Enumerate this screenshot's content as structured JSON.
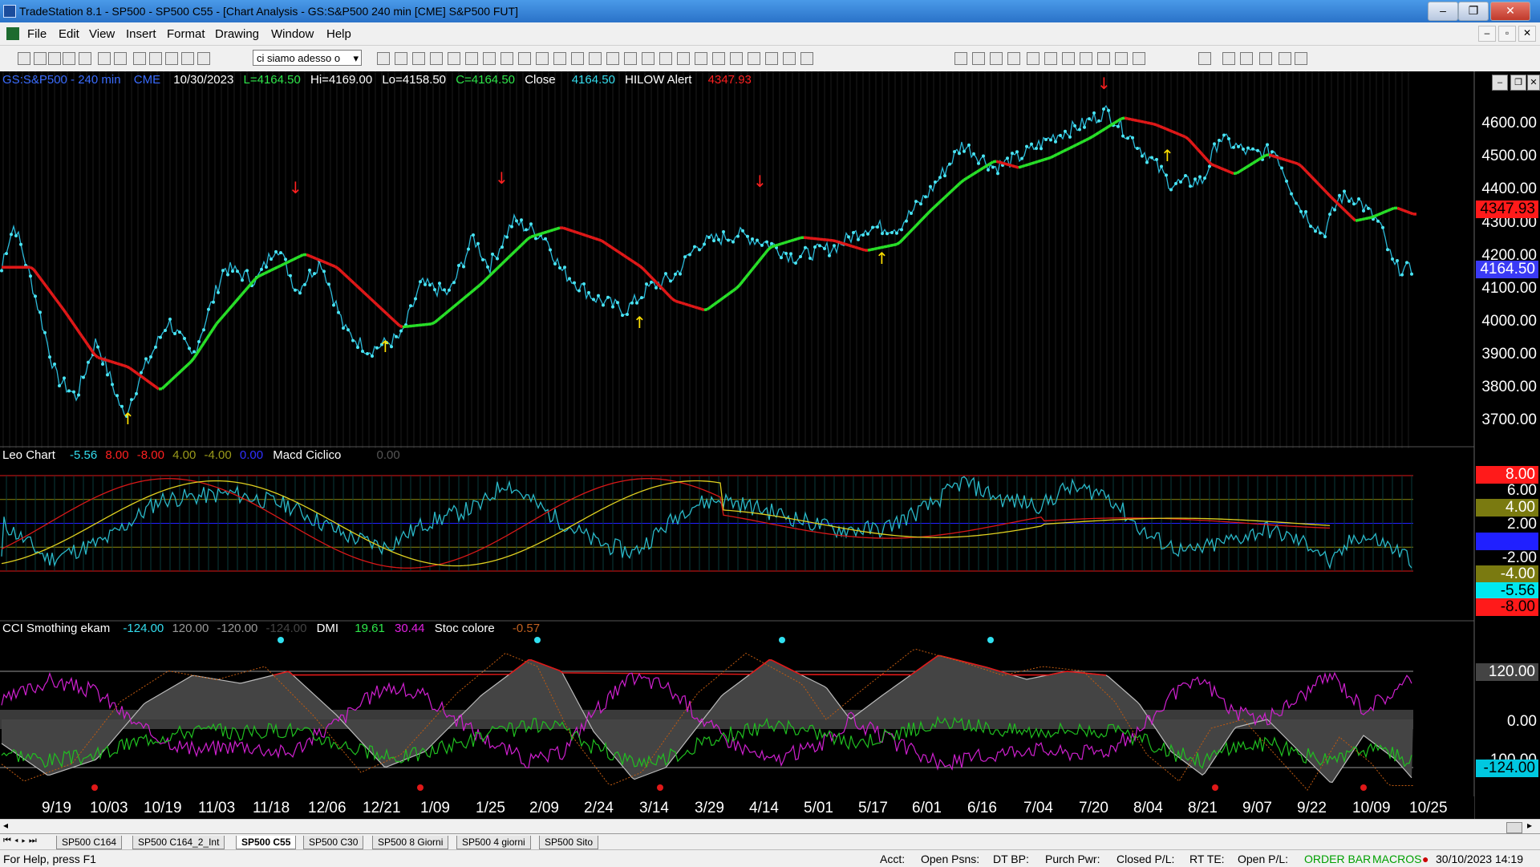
{
  "window": {
    "title": "TradeStation 8.1 - SP500 - SP500 C55 - [Chart Analysis - GS:S&P500  240 min  [CME] S&P500 FUT]",
    "minimize": "‒",
    "restore": "❐",
    "close": "✕"
  },
  "menu": {
    "items": [
      "File",
      "Edit",
      "View",
      "Insert",
      "Format",
      "Drawing",
      "Window",
      "Help"
    ],
    "mdi_minimize": "‒",
    "mdi_restore": "▫",
    "mdi_close": "✕"
  },
  "toolbar": {
    "workspace_select": "ci siamo adesso o",
    "icons": [
      "new-icon",
      "open-icon",
      "save-all-icon",
      "copy-icon",
      "folder-icon",
      "print-preview-icon",
      "print-icon",
      "link-icon",
      "link-2-icon",
      "lock-icon",
      "tool-icon",
      "globe-icon",
      "arrow-right-icon",
      "binoculars-icon",
      "chart-icon",
      "chart-2-icon",
      "grid-icon",
      "line-icon",
      "cycle-icon",
      "bars-icon",
      "candle-icon",
      "tick-icon",
      "zoom-in-icon",
      "zoom-out-icon",
      "pointer-icon",
      "hand-icon",
      "eraser-icon",
      "insert-icon",
      "trendline-icon",
      "fib-icon",
      "hline-icon",
      "vline-icon",
      "channel-icon",
      "arrow-icon",
      "ellipse-icon",
      "rect-icon",
      "text-icon"
    ]
  },
  "price_panel": {
    "header": {
      "symbol": "GS:S&P500 - 240 min",
      "exchange": "CME",
      "date": "10/30/2023",
      "open": "L=4164.50",
      "high": "Hi=4169.00",
      "low": "Lo=4158.50",
      "close": "C=4164.50",
      "close_label": "Close",
      "close_value": "4164.50",
      "alert_label": "HILOW Alert",
      "alert_value": "4347.93"
    },
    "axis_labels": [
      "4600.00",
      "4500.00",
      "4400.00",
      "4300.00",
      "4200.00",
      "4100.00",
      "4000.00",
      "3900.00",
      "3800.00",
      "3700.00"
    ],
    "markers": {
      "alert_box": "4347.93",
      "last_box": "4164.50"
    }
  },
  "leo_panel": {
    "header": {
      "name": "Leo Chart",
      "v1": "-5.56",
      "v2": "8.00",
      "v3": "-8.00",
      "v4": "4.00",
      "v5": "-4.00",
      "v6": "0.00",
      "name2": "Macd Ciclico",
      "v7": "0.00"
    },
    "axis_labels": [
      "8.00",
      "6.00",
      "4.00",
      "2.00",
      "0.00",
      "-2.00",
      "-4.00",
      "-5.56",
      "-8.00"
    ]
  },
  "cci_panel": {
    "header": {
      "name": "CCI Smothing ekam",
      "v1": "-124.00",
      "v2": "120.00",
      "v3": "-120.00",
      "v4": "-124.00",
      "name2": "DMI",
      "v5": "19.61",
      "v6": "30.44",
      "name3": "Stoc colore",
      "v7": "-0.57"
    },
    "axis_labels": [
      "120.00",
      "0.00",
      "-100.00",
      "-124.00"
    ]
  },
  "date_axis": [
    "9/19",
    "10/03",
    "10/19",
    "11/03",
    "11/18",
    "12/06",
    "12/21",
    "1/09",
    "1/25",
    "2/09",
    "2/24",
    "3/14",
    "3/29",
    "4/14",
    "5/01",
    "5/17",
    "6/01",
    "6/16",
    "7/04",
    "7/20",
    "8/04",
    "8/21",
    "9/07",
    "9/22",
    "10/09",
    "10/25"
  ],
  "tabs": [
    "SP500 C164",
    "SP500 C164_2_Int",
    "SP500 C55",
    "SP500 C30",
    "SP500 8 Giorni",
    "SP500 4 giorni",
    "SP500 Sito"
  ],
  "active_tab": "SP500 C55",
  "status": {
    "help": "For Help, press F1",
    "acct": "Acct:",
    "open_psns": "Open Psns:",
    "dt_bp": "DT BP:",
    "purch_pwr": "Purch Pwr:",
    "closed_pl": "Closed P/L:",
    "rt_te": "RT TE:",
    "open_pl": "Open P/L:",
    "order_bar": "ORDER BAR",
    "macros": "MACROS",
    "datetime": "30/10/2023 14:19"
  }
}
